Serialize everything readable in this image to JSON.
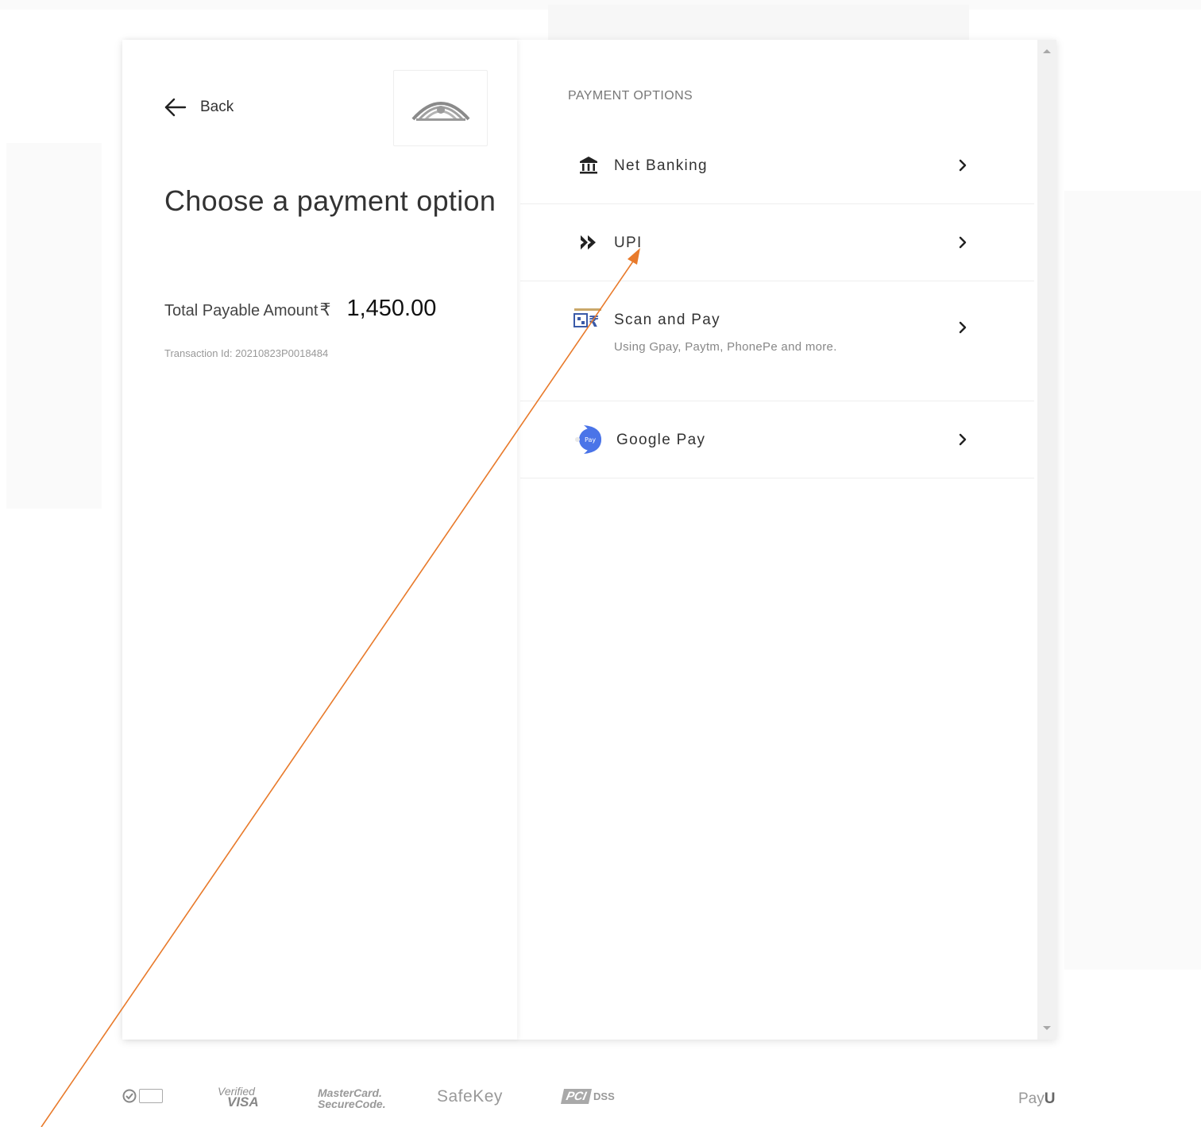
{
  "nav": {
    "back_label": "Back"
  },
  "header": {
    "title": "Choose a payment option"
  },
  "summary": {
    "amount_label": "Total Payable Amount",
    "currency_symbol": "₹",
    "amount_value": "1,450.00",
    "transaction_id": "Transaction Id: 20210823P0018484"
  },
  "payment": {
    "section_label": "PAYMENT OPTIONS",
    "options": [
      {
        "title": "Net Banking",
        "icon": "bank-icon"
      },
      {
        "title": "UPI",
        "icon": "upi-icon"
      },
      {
        "title": "Scan and Pay",
        "subtitle": "Using Gpay, Paytm, PhonePe and more.",
        "icon": "qr-rupee-icon"
      },
      {
        "title": "Google Pay",
        "icon": "google-pay-icon"
      }
    ]
  },
  "footer": {
    "badges": {
      "visa_top": "Verified",
      "visa_bottom": "VISA",
      "mastercard_top": "MasterCard.",
      "mastercard_bottom": "SecureCode.",
      "safekey": "SafeKey",
      "pci": "PCI",
      "pci_dss": "DSS",
      "payu_left": "Pay",
      "payu_right": "U"
    }
  },
  "colors": {
    "accent": "#6b87d2",
    "annotation_arrow": "#e87a2b",
    "title_text": "#333333",
    "muted_text": "#999999"
  }
}
